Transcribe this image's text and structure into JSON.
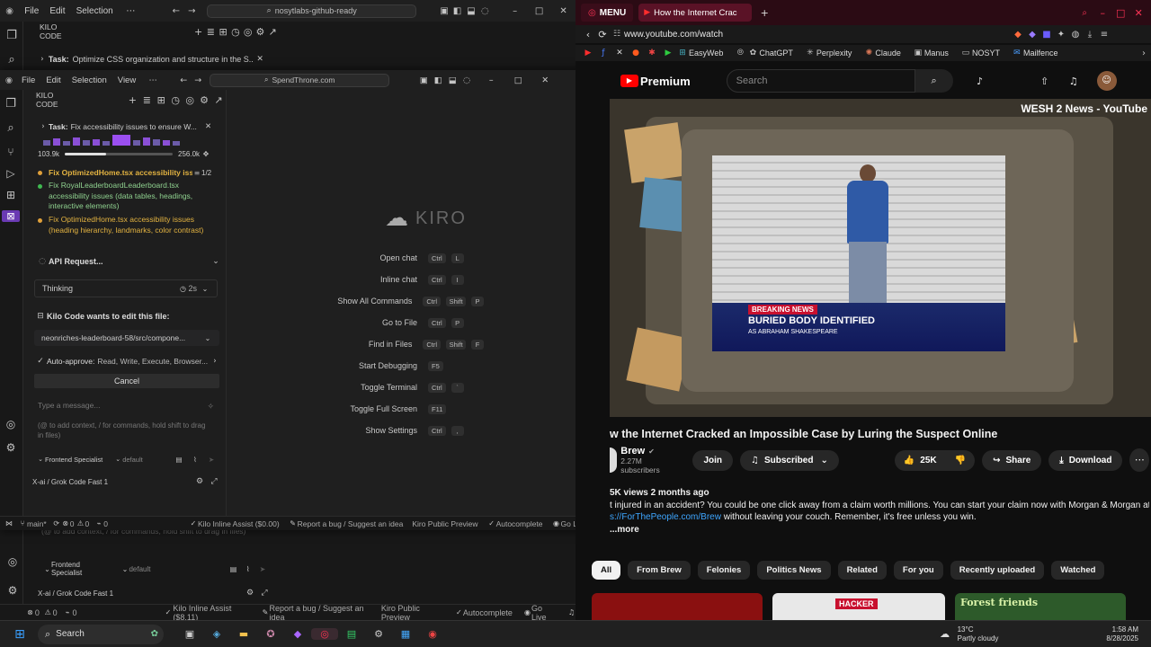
{
  "ide_back": {
    "menu": [
      "File",
      "Edit",
      "Selection"
    ],
    "search": "nosytlabs-github-ready",
    "panel_title": "KILO CODE",
    "task_label": "Task:",
    "task_text": "Optimize CSS organization and structure in the S...",
    "context_hint": "(@ to add context, / for commands, hold shift to drag in files)",
    "mode": "Frontend Specialist",
    "profile": "default",
    "model": "X-ai / Grok Code Fast 1",
    "status": [
      "0",
      "0",
      "0",
      "Kilo Inline Assist ($8.11)",
      "Report a bug / Suggest an idea",
      "Kiro Public Preview",
      "Autocomplete",
      "Go Live"
    ]
  },
  "ide_front": {
    "menu": [
      "File",
      "Edit",
      "Selection",
      "View"
    ],
    "search": "SpendThrone.com",
    "panel_title": "KILO CODE",
    "task_label": "Task:",
    "task_text": "Fix accessibility issues to ensure W...",
    "tokens_left": "103.9k",
    "tokens_right": "256.0k",
    "todo_current": "Fix OptimizedHome.tsx accessibility iss...",
    "todo_count": "1/2",
    "todo_done": "Fix RoyalLeaderboardLeaderboard.tsx accessibility issues (data tables, headings, interactive elements)",
    "todo_pending": "Fix OptimizedHome.tsx accessibility issues (heading hierarchy, landmarks, color contrast)",
    "api_request": "API Request...",
    "thinking": "Thinking",
    "thinking_time": "2s",
    "edit_title": "Kilo Code wants to edit this file:",
    "edit_file": "neonriches-leaderboard-58/src/compone...",
    "auto_approve_label": "Auto-approve:",
    "auto_approve_value": "Read, Write, Execute, Browser...",
    "cancel": "Cancel",
    "input_placeholder": "Type a message...",
    "context_hint": "(@ to add context, / for commands, hold shift to drag in files)",
    "mode": "Frontend Specialist",
    "profile": "default",
    "model": "X-ai / Grok Code Fast 1",
    "logo": "KIRO",
    "shortcuts": [
      {
        "label": "Open chat",
        "keys": [
          "Ctrl",
          "L"
        ]
      },
      {
        "label": "Inline chat",
        "keys": [
          "Ctrl",
          "I"
        ]
      },
      {
        "label": "Show All Commands",
        "keys": [
          "Ctrl",
          "Shift",
          "P"
        ]
      },
      {
        "label": "Go to File",
        "keys": [
          "Ctrl",
          "P"
        ]
      },
      {
        "label": "Find in Files",
        "keys": [
          "Ctrl",
          "Shift",
          "F"
        ]
      },
      {
        "label": "Start Debugging",
        "keys": [
          "F5"
        ]
      },
      {
        "label": "Toggle Terminal",
        "keys": [
          "Ctrl",
          "`"
        ]
      },
      {
        "label": "Toggle Full Screen",
        "keys": [
          "F11"
        ]
      },
      {
        "label": "Show Settings",
        "keys": [
          "Ctrl",
          ","
        ]
      }
    ],
    "status": [
      "main*",
      "0",
      "0",
      "0",
      "Kilo Inline Assist ($0.00)",
      "Report a bug / Suggest an idea",
      "Kiro Public Preview",
      "Autocomplete",
      "Go Live"
    ]
  },
  "browser": {
    "menu_btn": "MENU",
    "tab_title": "How the Internet Crac",
    "url": "www.youtube.com/watch",
    "bookmarks": [
      "EasyWeb",
      "ChatGPT",
      "Perplexity",
      "Claude",
      "Manus",
      "NOSYT",
      "Mailfence"
    ],
    "yt_logo": "Premium",
    "search_placeholder": "Search",
    "channel_overlay": "WESH 2 News - YouTube",
    "breaking": "BREAKING NEWS",
    "headline": "BURIED BODY IDENTIFIED",
    "subline": "AS ABRAHAM SHAKESPEARE",
    "video_title": "w the Internet Cracked an Impossible Case by Luring the Suspect Online",
    "channel": "Brew",
    "subscribers": "2.27M subscribers",
    "join": "Join",
    "subscribed": "Subscribed",
    "likes": "25K",
    "share": "Share",
    "download": "Download",
    "views": "5K views  2 months ago",
    "desc1": "t injured in an accident? You could be one click away from a claim worth millions. You can start your claim now with Morgan & Morgan at",
    "desc_link": "s://ForThePeople.com/Brew",
    "desc2": " without leaving your couch. Remember, it's free unless you win.",
    "more": "...more",
    "chips": [
      "All",
      "From Brew",
      "Felonies",
      "Politics News",
      "Related",
      "For you",
      "Recently uploaded",
      "Watched"
    ],
    "thumb_hacker": "HACKER",
    "thumb_forest": "Forest friends"
  },
  "taskbar": {
    "search": "Search",
    "weather_temp": "13°C",
    "weather_desc": "Partly cloudy",
    "time": "1:58 AM",
    "date": "8/28/2025"
  }
}
